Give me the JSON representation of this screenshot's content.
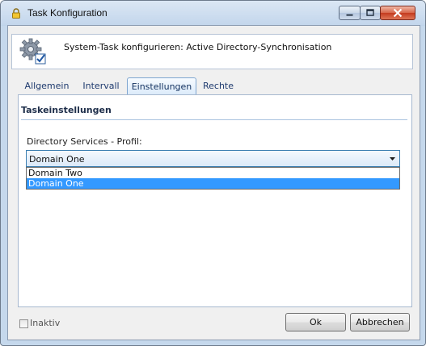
{
  "window": {
    "title": "Task Konfiguration"
  },
  "header": {
    "text": "System-Task konfigurieren: Active Directory-Synchronisation"
  },
  "tabs": [
    {
      "label": "Allgemein",
      "active": false
    },
    {
      "label": "Intervall",
      "active": false
    },
    {
      "label": "Einstellungen",
      "active": true
    },
    {
      "label": "Rechte",
      "active": false
    }
  ],
  "section": {
    "title": "Taskeinstellungen",
    "field_label": "Directory Services - Profil:"
  },
  "profile_select": {
    "value": "Domain One",
    "options": [
      "Domain Two",
      "Domain One"
    ],
    "highlighted_option": "Domain One"
  },
  "footer": {
    "inactive_label": "Inaktiv",
    "inactive_checked": false,
    "ok_label": "Ok",
    "cancel_label": "Abbrechen"
  },
  "colors": {
    "selection": "#3399ff",
    "accent_border": "#3c7fb1",
    "close_button": "#c43b1f"
  },
  "icons": [
    "lock-icon",
    "minimize-icon",
    "maximize-icon",
    "close-icon",
    "settings-gear-icon",
    "dropdown-arrow-icon"
  ]
}
